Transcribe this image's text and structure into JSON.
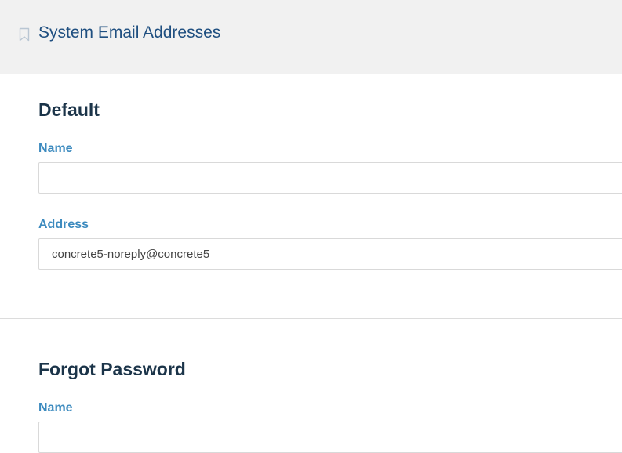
{
  "header": {
    "title": "System Email Addresses",
    "icon": "bookmark-icon"
  },
  "sections": [
    {
      "title": "Default",
      "fields": [
        {
          "label": "Name",
          "value": "",
          "placeholder": ""
        },
        {
          "label": "Address",
          "value": "concrete5-noreply@concrete5",
          "placeholder": ""
        }
      ]
    },
    {
      "title": "Forgot Password",
      "fields": [
        {
          "label": "Name",
          "value": "",
          "placeholder": ""
        }
      ]
    }
  ]
}
